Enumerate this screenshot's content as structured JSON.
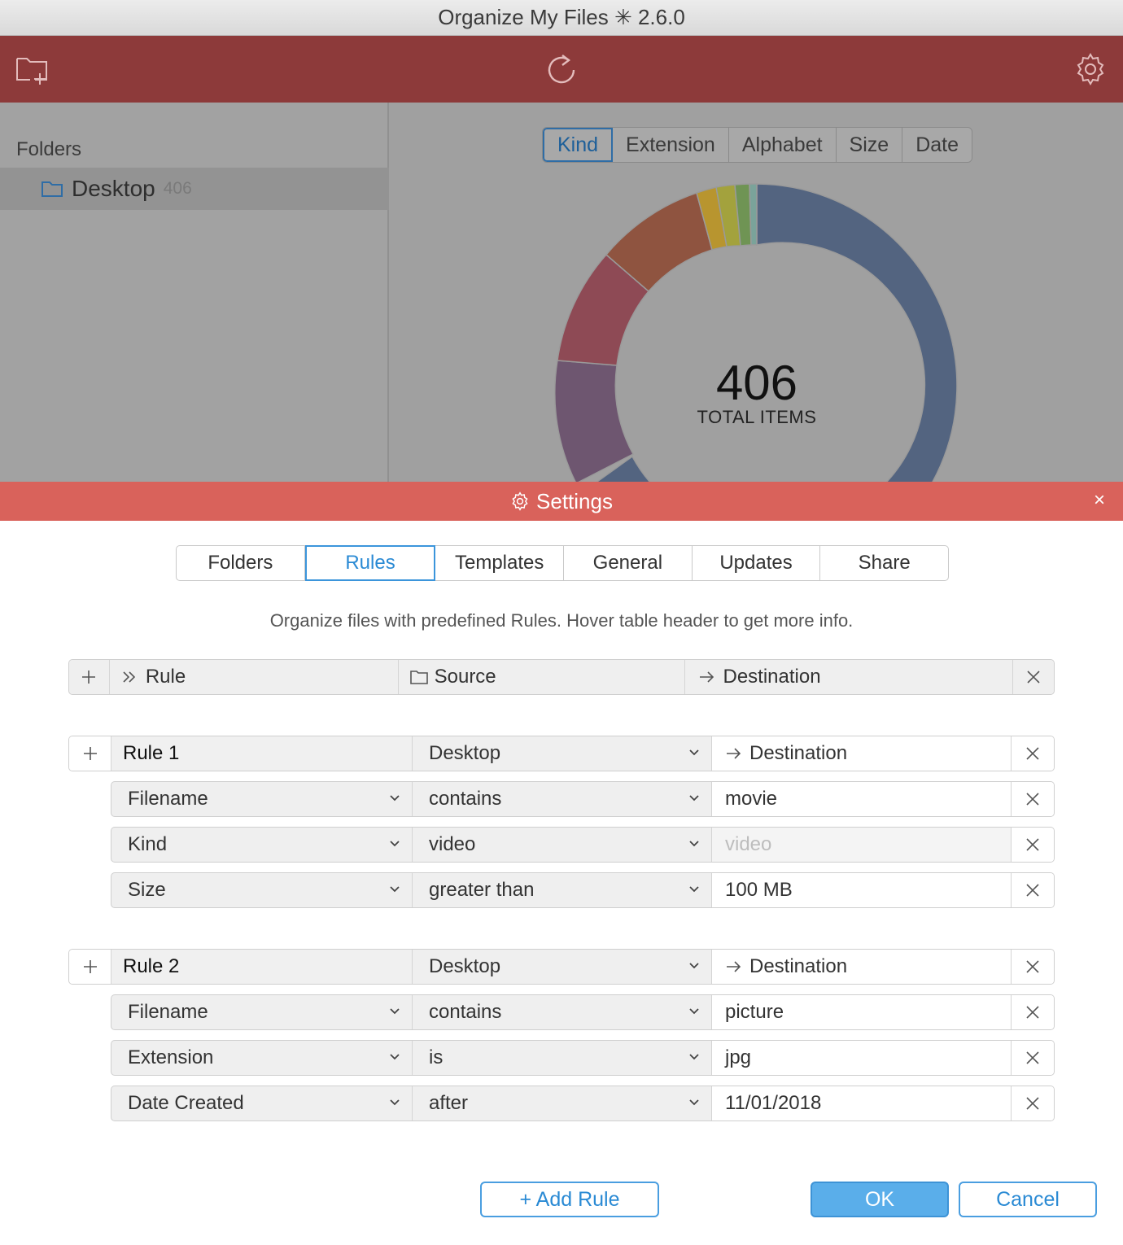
{
  "window": {
    "title": "Organize My Files ✳ 2.6.0"
  },
  "toolbar": {
    "add_folder_icon": "folder-plus-icon",
    "refresh_icon": "refresh-icon",
    "settings_icon": "gear-icon"
  },
  "sidebar": {
    "heading": "Folders",
    "items": [
      {
        "label": "Desktop",
        "count": "406"
      }
    ]
  },
  "view_tabs": [
    "Kind",
    "Extension",
    "Alphabet",
    "Size",
    "Date"
  ],
  "view_tabs_active": "Kind",
  "summary": {
    "total": "406",
    "total_label": "TOTAL ITEMS"
  },
  "chart_colors": [
    "#536480",
    "#6e5670",
    "#8e4a55",
    "#8f5440",
    "#b8952f",
    "#a3a23d",
    "#6f9454",
    "#7aa39a"
  ],
  "settings": {
    "title": "Settings",
    "close": "×",
    "tabs": [
      "Folders",
      "Rules",
      "Templates",
      "General",
      "Updates",
      "Share"
    ],
    "active_tab": "Rules",
    "description": "Organize files with predefined Rules. Hover table header to get more info.",
    "table_header": {
      "rule": "Rule",
      "source": "Source",
      "destination": "Destination"
    },
    "rules": [
      {
        "name": "Rule 1",
        "source": "Desktop",
        "destination": "Destination",
        "conditions": [
          {
            "field": "Filename",
            "operator": "contains",
            "value": "movie",
            "placeholder": ""
          },
          {
            "field": "Kind",
            "operator": "video",
            "value": "",
            "placeholder": "video"
          },
          {
            "field": "Size",
            "operator": "greater than",
            "value": "100 MB",
            "placeholder": ""
          }
        ]
      },
      {
        "name": "Rule 2",
        "source": "Desktop",
        "destination": "Destination",
        "conditions": [
          {
            "field": "Filename",
            "operator": "contains",
            "value": "picture",
            "placeholder": ""
          },
          {
            "field": "Extension",
            "operator": "is",
            "value": "jpg",
            "placeholder": ""
          },
          {
            "field": "Date Created",
            "operator": "after",
            "value": "11/01/2018",
            "placeholder": ""
          }
        ]
      }
    ],
    "buttons": {
      "add_rule": "+ Add Rule",
      "ok": "OK",
      "cancel": "Cancel"
    }
  }
}
